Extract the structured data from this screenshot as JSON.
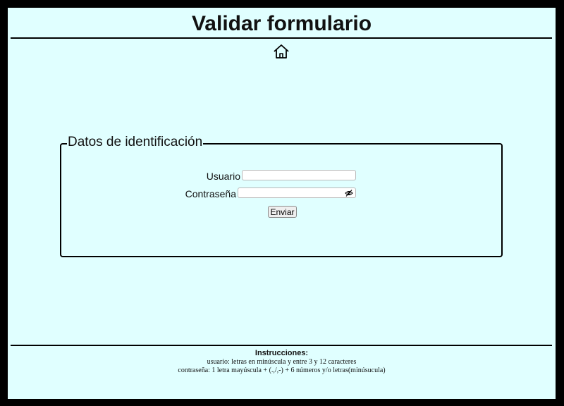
{
  "header": {
    "title": "Validar formulario",
    "home_icon": "home-icon"
  },
  "form": {
    "legend": "Datos de identificación",
    "username": {
      "label": "Usuario",
      "value": "",
      "placeholder": ""
    },
    "password": {
      "label": "Contraseña",
      "value": "",
      "placeholder": "",
      "toggle_icon": "eye-off-icon"
    },
    "submit_label": "Enviar"
  },
  "footer": {
    "heading": "Instrucciones:",
    "line1": "usuario: letras en minúscula y entre 3 y 12 caracteres",
    "line2": "contraseña: 1 letra mayúscula + (.,/,-) + 6 números y/o letras(minúsucula)"
  },
  "colors": {
    "background": "#e0ffff",
    "frame": "#000000",
    "text": "#111111"
  }
}
